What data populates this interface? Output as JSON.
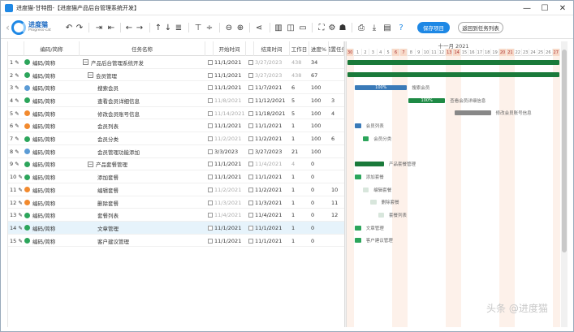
{
  "window": {
    "title": "进度猫-甘特图-【进度猫产品后台管理系统开发】",
    "minimize_glyph": "—",
    "maximize_glyph": "☐",
    "close_glyph": "✕"
  },
  "logo": {
    "name": "进度猫",
    "sub": "Progress-cat"
  },
  "toolbar": {
    "save_label": "保存项目",
    "return_label": "返回到任务列表"
  },
  "grid": {
    "headers": [
      "",
      "编码/简称",
      "任务名称",
      "",
      "开始时间",
      "",
      "结束时间",
      "工作日",
      "进度%",
      "前置任务"
    ],
    "rows": [
      {
        "num": "1",
        "dot": "#2ca55b",
        "code": "编码/简称",
        "expander": "−",
        "name": "产品后台管理系统开发",
        "start": "11/1/2021",
        "start_gray": false,
        "end": "3/27/2023",
        "end_gray": true,
        "days": "438",
        "days_gray": true,
        "progress": "34",
        "pred": ""
      },
      {
        "num": "2",
        "dot": "#2ca55b",
        "code": "编码/简称",
        "expander": "−",
        "name": "会员管理",
        "start": "11/1/2021",
        "start_gray": false,
        "end": "3/27/2023",
        "end_gray": true,
        "days": "438",
        "days_gray": true,
        "progress": "67",
        "pred": ""
      },
      {
        "num": "3",
        "dot": "#5b9bd5",
        "code": "编码/简称",
        "expander": "",
        "name": "搜索会员",
        "start": "11/1/2021",
        "start_gray": false,
        "end": "11/7/2021",
        "end_gray": false,
        "days": "6",
        "days_gray": false,
        "progress": "100",
        "pred": ""
      },
      {
        "num": "4",
        "dot": "#2ca55b",
        "code": "编码/简称",
        "expander": "",
        "name": "查看会员详细信息",
        "start": "11/8/2021",
        "start_gray": true,
        "end": "11/12/2021",
        "end_gray": false,
        "days": "5",
        "days_gray": false,
        "progress": "100",
        "pred": "3"
      },
      {
        "num": "5",
        "dot": "#f28a2e",
        "code": "编码/简称",
        "expander": "",
        "name": "修改会员账号信息",
        "start": "11/14/2021",
        "start_gray": true,
        "end": "11/18/2021",
        "end_gray": false,
        "days": "5",
        "days_gray": false,
        "progress": "100",
        "pred": "4"
      },
      {
        "num": "6",
        "dot": "#f28a2e",
        "code": "编码/简称",
        "expander": "",
        "name": "会员列表",
        "start": "11/1/2021",
        "start_gray": false,
        "end": "11/1/2021",
        "end_gray": false,
        "days": "1",
        "days_gray": false,
        "progress": "100",
        "pred": ""
      },
      {
        "num": "7",
        "dot": "#2ca55b",
        "code": "编码/简称",
        "expander": "",
        "name": "会员分类",
        "start": "11/2/2021",
        "start_gray": true,
        "end": "11/2/2021",
        "end_gray": false,
        "days": "1",
        "days_gray": false,
        "progress": "100",
        "pred": "6"
      },
      {
        "num": "8",
        "dot": "#5b9bd5",
        "code": "编码/简称",
        "expander": "",
        "name": "会员管理功能添加",
        "start": "3/3/2023",
        "start_gray": false,
        "end": "3/27/2023",
        "end_gray": false,
        "days": "21",
        "days_gray": false,
        "progress": "100",
        "pred": ""
      },
      {
        "num": "9",
        "dot": "#2ca55b",
        "code": "编码/简称",
        "expander": "−",
        "name": "产品套餐管理",
        "start": "11/1/2021",
        "start_gray": false,
        "end": "11/4/2021",
        "end_gray": true,
        "days": "4",
        "days_gray": true,
        "progress": "0",
        "pred": ""
      },
      {
        "num": "10",
        "dot": "#2ca55b",
        "code": "编码/简称",
        "expander": "",
        "name": "添加套餐",
        "start": "11/1/2021",
        "start_gray": false,
        "end": "11/1/2021",
        "end_gray": false,
        "days": "1",
        "days_gray": false,
        "progress": "0",
        "pred": ""
      },
      {
        "num": "11",
        "dot": "#f28a2e",
        "code": "编码/简称",
        "expander": "",
        "name": "编辑套餐",
        "start": "11/2/2021",
        "start_gray": true,
        "end": "11/2/2021",
        "end_gray": false,
        "days": "1",
        "days_gray": false,
        "progress": "0",
        "pred": "10"
      },
      {
        "num": "12",
        "dot": "#f28a2e",
        "code": "编码/简称",
        "expander": "",
        "name": "删除套餐",
        "start": "11/3/2021",
        "start_gray": true,
        "end": "11/3/2021",
        "end_gray": false,
        "days": "1",
        "days_gray": false,
        "progress": "0",
        "pred": "11"
      },
      {
        "num": "13",
        "dot": "#2ca55b",
        "code": "编码/简称",
        "expander": "",
        "name": "套餐列表",
        "start": "11/4/2021",
        "start_gray": true,
        "end": "11/4/2021",
        "end_gray": false,
        "days": "1",
        "days_gray": false,
        "progress": "0",
        "pred": "12"
      },
      {
        "num": "14",
        "dot": "#2ca55b",
        "code": "编码/简称",
        "expander": "",
        "name": "文章管理",
        "start": "11/1/2021",
        "start_gray": false,
        "end": "11/1/2021",
        "end_gray": false,
        "days": "1",
        "days_gray": false,
        "progress": "0",
        "pred": "",
        "selected": true
      },
      {
        "num": "15",
        "dot": "#2ca55b",
        "code": "编码/简称",
        "expander": "",
        "name": "客户建议管理",
        "start": "11/1/2021",
        "start_gray": false,
        "end": "11/1/2021",
        "end_gray": false,
        "days": "1",
        "days_gray": false,
        "progress": "0",
        "pred": ""
      }
    ]
  },
  "gantt": {
    "month_label": "十一月 2021",
    "days": [
      "30",
      "1",
      "2",
      "3",
      "4",
      "5",
      "6",
      "7",
      "8",
      "9",
      "10",
      "11",
      "12",
      "13",
      "14",
      "15",
      "16",
      "17",
      "18",
      "19",
      "20",
      "21",
      "22",
      "23",
      "24",
      "25",
      "26",
      "27"
    ],
    "weekend_days": [
      "30",
      "6",
      "7",
      "13",
      "14",
      "20",
      "21",
      "27"
    ],
    "bars": [
      {
        "row": 1,
        "label": "",
        "color": "#1a7a3a",
        "start_day": "30",
        "end_day": "27"
      },
      {
        "row": 2,
        "label": "",
        "color": "#1a7a3a",
        "start_day": "30",
        "end_day": "27"
      },
      {
        "row": 3,
        "label": "搜索会员",
        "color": "#3a7ab8",
        "start_day": "1",
        "end_day": "7",
        "pct": "100%"
      },
      {
        "row": 4,
        "label": "查看会员详细信息",
        "color": "#1e8a45",
        "start_day": "8",
        "end_day": "12",
        "pct": "100%"
      },
      {
        "row": 5,
        "label": "修改会员账号信息",
        "color": "#888888",
        "start_day": "14",
        "end_day": "18"
      },
      {
        "row": 6,
        "label": "会员列表",
        "color": "#3a7ab8",
        "start_day": "1",
        "end_day": "1"
      },
      {
        "row": 7,
        "label": "会员分类",
        "color": "#2ca55b",
        "start_day": "2",
        "end_day": "2"
      },
      {
        "row": 9,
        "label": "产品套餐管理",
        "color": "#1a7a3a",
        "start_day": "1",
        "end_day": "4"
      },
      {
        "row": 10,
        "label": "添加套餐",
        "color": "#2ca55b",
        "start_day": "1",
        "end_day": "1"
      },
      {
        "row": 11,
        "label": "编辑套餐",
        "color": "#d8e6dc",
        "start_day": "2",
        "end_day": "2"
      },
      {
        "row": 12,
        "label": "删除套餐",
        "color": "#d8e6dc",
        "start_day": "3",
        "end_day": "3"
      },
      {
        "row": 13,
        "label": "套餐列表",
        "color": "#d8e6dc",
        "start_day": "4",
        "end_day": "4"
      },
      {
        "row": 14,
        "label": "文章管理",
        "color": "#2ca55b",
        "start_day": "1",
        "end_day": "1"
      },
      {
        "row": 15,
        "label": "客户建议管理",
        "color": "#2ca55b",
        "start_day": "1",
        "end_day": "1"
      }
    ]
  },
  "watermark": "头条 @进度猫"
}
